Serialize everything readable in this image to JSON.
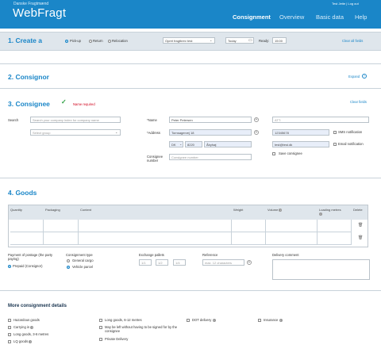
{
  "header": {
    "brand_small": "Danske Fragtmænd",
    "brand": "WebFragt",
    "user_links": "Test Jette  |  Log out",
    "nav": [
      "Consignment",
      "Overview",
      "Basic data",
      "Help"
    ],
    "accent": "#1a86c8"
  },
  "create": {
    "title": "1. Create a",
    "options": [
      "Pick-up",
      "Return",
      "Relocation"
    ],
    "selected_option": "Pick-up",
    "template_value": "Opret fragtbrev test",
    "date_value": "Today",
    "ready_label": "Ready:",
    "ready_value": "15:00",
    "clear_all": "Clear all fields"
  },
  "consignor": {
    "title": "2. Consignor",
    "expand": "Expand"
  },
  "consignee": {
    "title": "3. Consignee",
    "name_required": "Name required",
    "clear": "Clear fields",
    "search_label": "Search",
    "search_placeholder": "Search your company index for company name",
    "group_placeholder": "Select group",
    "name_label": "*Name",
    "name_value": "Peter Petersen",
    "address_label": "*Address",
    "address_value": "Tornsagervej 18",
    "country": "DK",
    "postcode": "8220",
    "city": "Åbyhøj",
    "number_label": "Consignee number",
    "number_placeholder": "Consignee number",
    "att_placeholder": "ATT:",
    "phone_value": "12345678",
    "email_value": "test@test.dk",
    "sms_label": "SMS notification",
    "email_notify_label": "Email notification",
    "save_label": "Save consignee"
  },
  "goods": {
    "title": "4. Goods",
    "columns": [
      "Quantity",
      "Packaging",
      "Content",
      "Weight",
      "Volume",
      "Loading metres",
      "Delete"
    ],
    "payment_label": "Payment of postage (the party paying)",
    "payment_option": "Prepaid (Consignor)",
    "type_label": "Consignment type",
    "type_options": [
      "General cargo",
      "Vehicle parcel"
    ],
    "selected_type": "Vehicle parcel",
    "pallets_label": "Exchange pallets",
    "pallet_placeholders": [
      "1/1",
      "1/2",
      "1/4"
    ],
    "reference_label": "Reference",
    "reference_placeholder": "max. 12 characters",
    "comment_label": "Delivery comment"
  },
  "more": {
    "title": "More consignment details",
    "col1": [
      "Hazardous goods",
      "Carrying in",
      "Long goods, 3-6 metres",
      "LQ goods"
    ],
    "col2": [
      "Long goods, 6-12 metres",
      "May be left without having to be signed for by the consignee",
      "Private Delivery"
    ],
    "col3": [
      "DOT delivery"
    ],
    "col4": [
      "Insurance"
    ]
  }
}
